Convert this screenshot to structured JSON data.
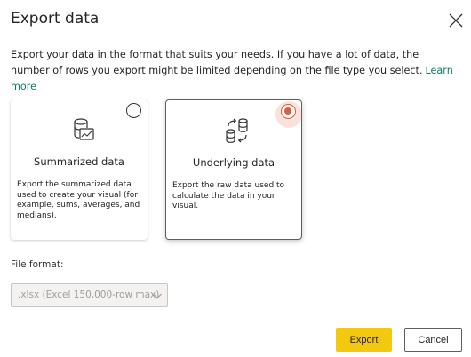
{
  "dialog": {
    "title": "Export data",
    "description": "Export your data in the format that suits your needs. If you have a lot of data, the number of rows you export might be limited depending on the file type you select.",
    "learn_more": "Learn more",
    "close_icon": "close-icon"
  },
  "options": {
    "summarized": {
      "title": "Summarized data",
      "description": "Export the summarized data used to create your visual (for example, sums, averages, and medians).",
      "selected": false,
      "icon": "database-chart-icon"
    },
    "underlying": {
      "title": "Underlying data",
      "description": "Export the raw data used to calculate the data in your visual.",
      "selected": true,
      "icon": "database-sync-icon"
    }
  },
  "file_format": {
    "label": "File format:",
    "value": ".xlsx (Excel 150,000-row max)",
    "disabled": true
  },
  "footer": {
    "export_label": "Export",
    "cancel_label": "Cancel"
  },
  "colors": {
    "accent": "#f2c811",
    "radio_selected": "#e15a3a",
    "link": "#117865"
  }
}
